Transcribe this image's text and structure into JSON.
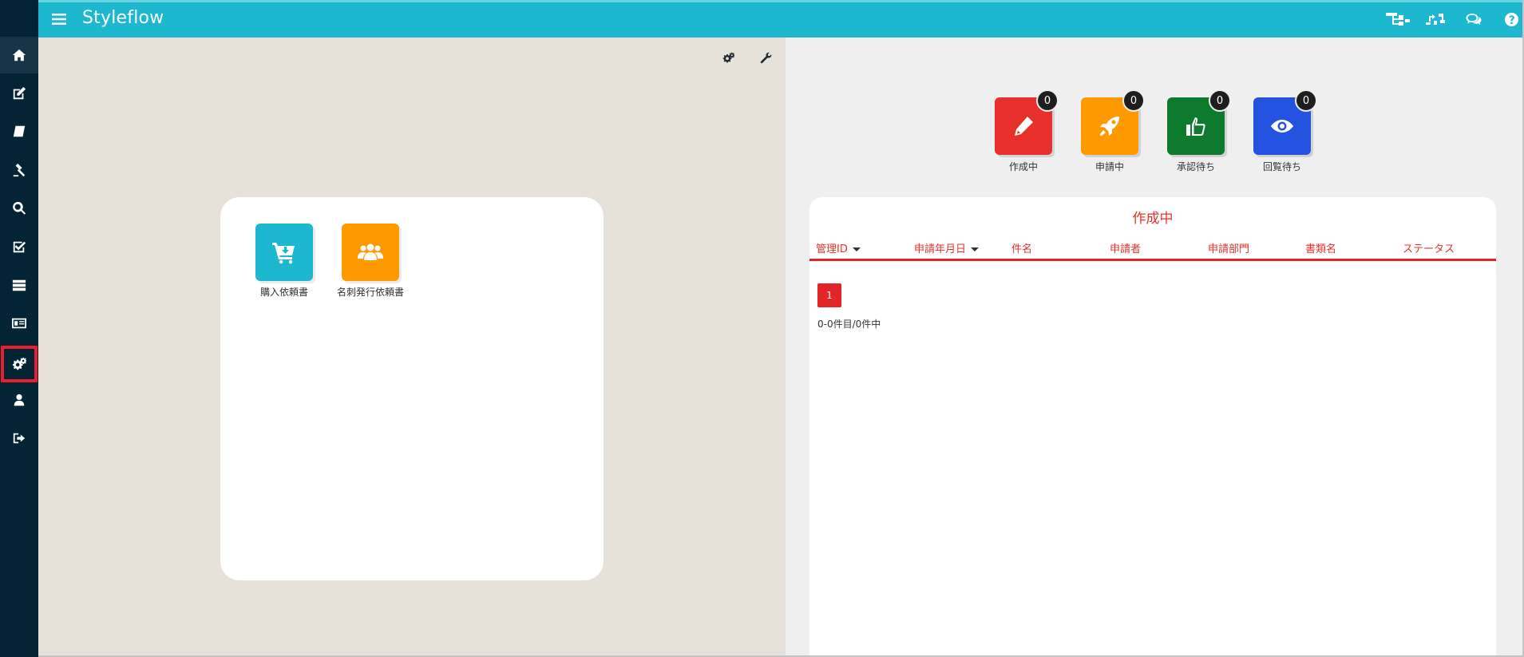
{
  "header": {
    "title": "Styleflow",
    "icons": [
      "menu-icon",
      "org-chart-icon",
      "flow-icon",
      "chat-icon",
      "help-icon"
    ]
  },
  "sidebar": {
    "items": [
      {
        "icon": "home-icon",
        "active": true
      },
      {
        "icon": "edit-icon"
      },
      {
        "icon": "book-icon"
      },
      {
        "icon": "gavel-icon"
      },
      {
        "icon": "search-icon"
      },
      {
        "icon": "checkbox-icon"
      },
      {
        "icon": "server-icon"
      },
      {
        "icon": "id-card-icon"
      },
      {
        "icon": "gears-icon",
        "highlighted": true
      },
      {
        "icon": "user-icon"
      },
      {
        "icon": "logout-icon"
      }
    ]
  },
  "left_panel": {
    "forms": [
      {
        "label": "購入依頼書",
        "icon": "cart-icon",
        "color": "#1db8d0"
      },
      {
        "label": "名刺発行依頼書",
        "icon": "users-icon",
        "color": "#ff9900"
      }
    ]
  },
  "status": [
    {
      "label": "作成中",
      "count": "0",
      "icon": "pencil-icon",
      "color": "#e8302a"
    },
    {
      "label": "申請中",
      "count": "0",
      "icon": "rocket-icon",
      "color": "#ff9900"
    },
    {
      "label": "承認待ち",
      "count": "0",
      "icon": "thumbs-up-icon",
      "color": "#0e7a2e"
    },
    {
      "label": "回覧待ち",
      "count": "0",
      "icon": "eye-icon",
      "color": "#2453e0"
    }
  ],
  "list": {
    "title": "作成中",
    "columns": [
      "管理ID",
      "申請年月日",
      "件名",
      "申請者",
      "申請部門",
      "書類名",
      "ステータス"
    ],
    "page": "1",
    "count_text": "0-0件目/0件中"
  }
}
